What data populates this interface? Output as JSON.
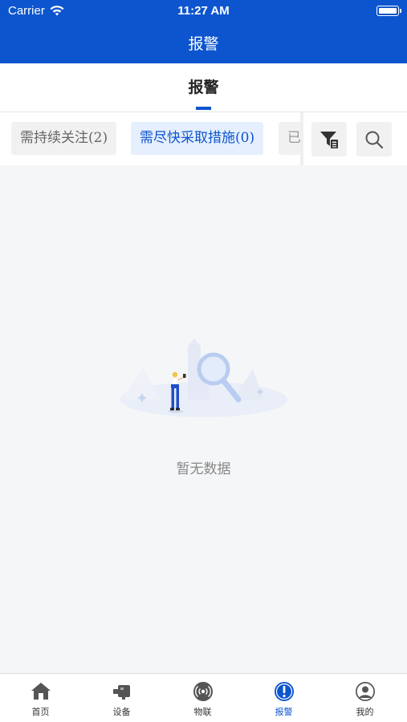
{
  "status_bar": {
    "carrier": "Carrier",
    "time": "11:27 AM"
  },
  "nav": {
    "title": "报警"
  },
  "tab": {
    "title": "报警"
  },
  "filters": {
    "chips": [
      "需持续关注(2)",
      "需尽快采取措施(0)",
      "已"
    ],
    "active_index": 1,
    "icons": [
      "filter-icon",
      "search-icon"
    ]
  },
  "empty_state": {
    "message": "暂无数据"
  },
  "tab_bar": {
    "items": [
      {
        "label": "首页",
        "icon": "home-icon"
      },
      {
        "label": "设备",
        "icon": "device-icon"
      },
      {
        "label": "物联",
        "icon": "iot-signal-icon"
      },
      {
        "label": "报警",
        "icon": "alarm-icon"
      },
      {
        "label": "我的",
        "icon": "profile-icon"
      }
    ],
    "active_index": 3
  },
  "colors": {
    "primary": "#0d55cf",
    "background": "#f5f6f7",
    "chip_active_bg": "#e6effd"
  }
}
